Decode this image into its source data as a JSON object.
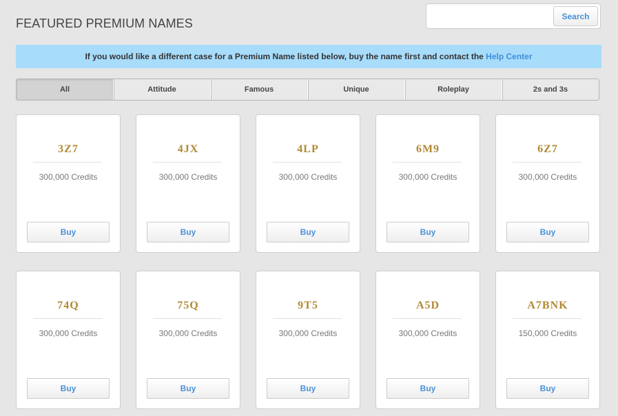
{
  "header": {
    "title": "FEATURED PREMIUM NAMES"
  },
  "search": {
    "value": "",
    "placeholder": "",
    "button_label": "Search"
  },
  "notice": {
    "text": "If you would like a different case for a Premium Name listed below, buy the name first and contact the ",
    "link_label": "Help Center",
    "background_color": "#a8dcfb"
  },
  "tabs": [
    {
      "label": "All",
      "active": true
    },
    {
      "label": "Attitude",
      "active": false
    },
    {
      "label": "Famous",
      "active": false
    },
    {
      "label": "Unique",
      "active": false
    },
    {
      "label": "Roleplay",
      "active": false
    },
    {
      "label": "2s and 3s",
      "active": false
    }
  ],
  "names": [
    {
      "name": "3Z7",
      "price": "300,000 Credits",
      "button_label": "Buy"
    },
    {
      "name": "4JX",
      "price": "300,000 Credits",
      "button_label": "Buy"
    },
    {
      "name": "4LP",
      "price": "300,000 Credits",
      "button_label": "Buy"
    },
    {
      "name": "6M9",
      "price": "300,000 Credits",
      "button_label": "Buy"
    },
    {
      "name": "6Z7",
      "price": "300,000 Credits",
      "button_label": "Buy"
    },
    {
      "name": "74Q",
      "price": "300,000 Credits",
      "button_label": "Buy"
    },
    {
      "name": "75Q",
      "price": "300,000 Credits",
      "button_label": "Buy"
    },
    {
      "name": "9T5",
      "price": "300,000 Credits",
      "button_label": "Buy"
    },
    {
      "name": "A5D",
      "price": "300,000 Credits",
      "button_label": "Buy"
    },
    {
      "name": "A7BNK",
      "price": "150,000 Credits",
      "button_label": "Buy"
    }
  ],
  "colors": {
    "name_gold": "#b08a35",
    "link_blue": "#3d8fdb"
  }
}
